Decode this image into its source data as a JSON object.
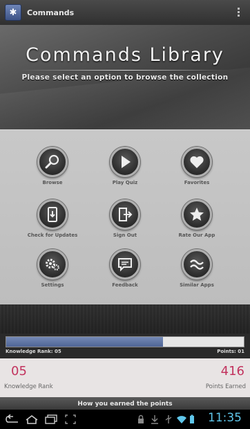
{
  "action_bar": {
    "title": "Commands"
  },
  "hero": {
    "title": "Commands Library",
    "subtitle": "Please select an option to browse the collection"
  },
  "menu": [
    {
      "label": "Browse",
      "icon": "search-icon"
    },
    {
      "label": "Play Quiz",
      "icon": "play-icon"
    },
    {
      "label": "Favorites",
      "icon": "heart-icon"
    },
    {
      "label": "Check for Updates",
      "icon": "update-icon"
    },
    {
      "label": "Sign Out",
      "icon": "sign-out-icon"
    },
    {
      "label": "Rate Our App",
      "icon": "star-icon"
    },
    {
      "label": "Settings",
      "icon": "gears-icon"
    },
    {
      "label": "Feedback",
      "icon": "chat-icon"
    },
    {
      "label": "Similar Apps",
      "icon": "approx-icon"
    }
  ],
  "progress": {
    "fraction": 0.66,
    "left_label": "Knowledge Rank: 05",
    "right_label": "Points: 01"
  },
  "stats": {
    "rank_value": "05",
    "rank_label": "Knowledge Rank",
    "points_value": "416",
    "points_label": "Points Earned"
  },
  "earned_header": "How you earned the points",
  "status_bar": {
    "time": "11:35"
  },
  "colors": {
    "accent": "#c2335e",
    "progress": "#5b70a0",
    "clock": "#5fc6ea"
  }
}
